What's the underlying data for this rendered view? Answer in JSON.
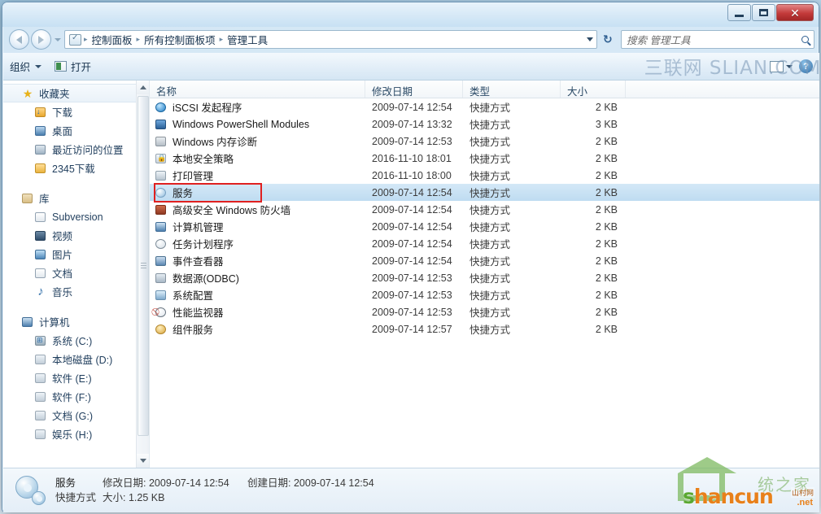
{
  "window": {
    "title": "",
    "controls": {
      "minimize": "—",
      "maximize": "▢",
      "close": "✕"
    }
  },
  "address": {
    "breadcrumbs": [
      "控制面板",
      "所有控制面板项",
      "管理工具"
    ],
    "separator": "▸",
    "refresh_icon": "↻",
    "back_tooltip": "后退",
    "forward_tooltip": "前进"
  },
  "search": {
    "placeholder": "搜索 管理工具",
    "value": "",
    "icon": "search-icon"
  },
  "toolbar": {
    "organize_label": "组织",
    "open_label": "打开",
    "help_label": "?",
    "watermark": "三联网 SLIAN.COM"
  },
  "sidebar": {
    "groups": [
      {
        "header": {
          "label": "收藏夹",
          "icon": "star-icon",
          "selected": true
        },
        "items": [
          {
            "label": "下载",
            "icon": "download-folder-icon"
          },
          {
            "label": "桌面",
            "icon": "desktop-icon"
          },
          {
            "label": "最近访问的位置",
            "icon": "recent-places-icon"
          },
          {
            "label": "2345下载",
            "icon": "folder-icon"
          }
        ]
      },
      {
        "header": {
          "label": "库",
          "icon": "library-icon",
          "selected": false
        },
        "items": [
          {
            "label": "Subversion",
            "icon": "document-icon"
          },
          {
            "label": "视频",
            "icon": "video-icon"
          },
          {
            "label": "图片",
            "icon": "picture-icon"
          },
          {
            "label": "文档",
            "icon": "document-icon"
          },
          {
            "label": "音乐",
            "icon": "music-icon"
          }
        ]
      },
      {
        "header": {
          "label": "计算机",
          "icon": "computer-icon",
          "selected": false
        },
        "items": [
          {
            "label": "系统 (C:)",
            "icon": "system-drive-icon"
          },
          {
            "label": "本地磁盘 (D:)",
            "icon": "drive-icon"
          },
          {
            "label": "软件 (E:)",
            "icon": "drive-icon"
          },
          {
            "label": "软件 (F:)",
            "icon": "drive-icon"
          },
          {
            "label": "文档 (G:)",
            "icon": "drive-icon"
          },
          {
            "label": "娱乐 (H:)",
            "icon": "drive-icon"
          }
        ]
      }
    ]
  },
  "filelist": {
    "columns": [
      "名称",
      "修改日期",
      "类型",
      "大小"
    ],
    "sorted_column": "名称",
    "rows": [
      {
        "name": "iSCSI 发起程序",
        "date": "2009-07-14 12:54",
        "type": "快捷方式",
        "size": "2 KB",
        "icon": "globe-icon",
        "selected": false
      },
      {
        "name": "Windows PowerShell Modules",
        "date": "2009-07-14 13:32",
        "type": "快捷方式",
        "size": "3 KB",
        "icon": "powershell-icon",
        "selected": false
      },
      {
        "name": "Windows 内存诊断",
        "date": "2009-07-14 12:53",
        "type": "快捷方式",
        "size": "2 KB",
        "icon": "memory-icon",
        "selected": false
      },
      {
        "name": "本地安全策略",
        "date": "2016-11-10 18:01",
        "type": "快捷方式",
        "size": "2 KB",
        "icon": "security-policy-icon",
        "selected": false
      },
      {
        "name": "打印管理",
        "date": "2016-11-10 18:00",
        "type": "快捷方式",
        "size": "2 KB",
        "icon": "printer-icon",
        "selected": false
      },
      {
        "name": "服务",
        "date": "2009-07-14 12:54",
        "type": "快捷方式",
        "size": "2 KB",
        "icon": "services-gear-icon",
        "selected": true
      },
      {
        "name": "高级安全 Windows 防火墙",
        "date": "2009-07-14 12:54",
        "type": "快捷方式",
        "size": "2 KB",
        "icon": "firewall-icon",
        "selected": false
      },
      {
        "name": "计算机管理",
        "date": "2009-07-14 12:54",
        "type": "快捷方式",
        "size": "2 KB",
        "icon": "computer-management-icon",
        "selected": false
      },
      {
        "name": "任务计划程序",
        "date": "2009-07-14 12:54",
        "type": "快捷方式",
        "size": "2 KB",
        "icon": "clock-icon",
        "selected": false
      },
      {
        "name": "事件查看器",
        "date": "2009-07-14 12:54",
        "type": "快捷方式",
        "size": "2 KB",
        "icon": "event-viewer-icon",
        "selected": false
      },
      {
        "name": "数据源(ODBC)",
        "date": "2009-07-14 12:53",
        "type": "快捷方式",
        "size": "2 KB",
        "icon": "odbc-icon",
        "selected": false
      },
      {
        "name": "系统配置",
        "date": "2009-07-14 12:53",
        "type": "快捷方式",
        "size": "2 KB",
        "icon": "system-config-icon",
        "selected": false
      },
      {
        "name": "性能监视器",
        "date": "2009-07-14 12:53",
        "type": "快捷方式",
        "size": "2 KB",
        "icon": "performance-monitor-icon",
        "selected": false
      },
      {
        "name": "组件服务",
        "date": "2009-07-14 12:57",
        "type": "快捷方式",
        "size": "2 KB",
        "icon": "component-services-icon",
        "selected": false
      }
    ]
  },
  "annotation": {
    "highlight_color": "#e02020",
    "target": "服务"
  },
  "statusbar": {
    "name": "服务",
    "modified_label": "修改日期:",
    "modified_value": "2009-07-14 12:54",
    "created_label": "创建日期:",
    "created_value": "2009-07-14 12:54",
    "type": "快捷方式",
    "size_label": "大小:",
    "size_value": "1.25 KB"
  },
  "watermark_bottom": {
    "cn_text": "统之家",
    "brand_s": "s",
    "brand_rest": "hancun",
    "suffix": ".net",
    "tag": "山村网"
  }
}
